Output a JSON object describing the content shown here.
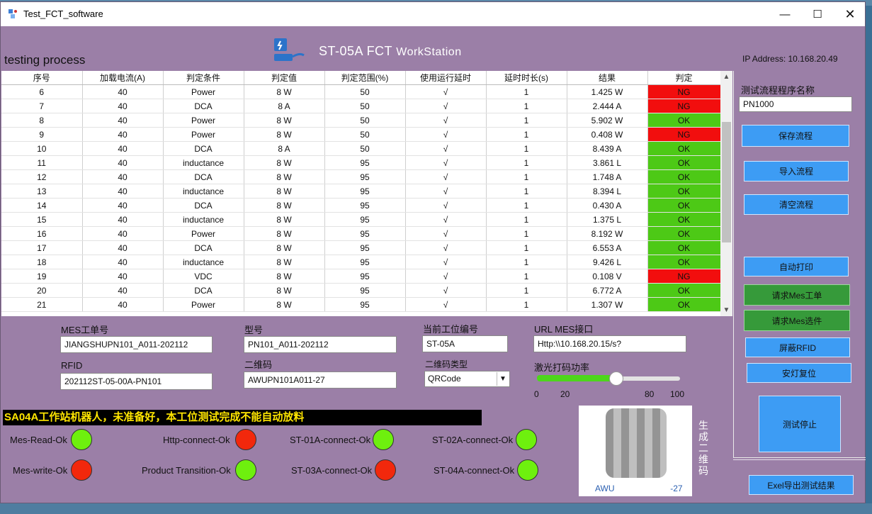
{
  "window": {
    "title": "Test_FCT_software",
    "controls": [
      "—",
      "☐",
      "✕"
    ]
  },
  "header": {
    "process_title": "testing process",
    "station_code": "ST-05A",
    "fct": "FCT",
    "workstation": "WorkStation",
    "ip_label": "IP Address:",
    "ip_value": "10.168.20.49"
  },
  "table": {
    "columns": [
      "序号",
      "加载电流(A)",
      "判定条件",
      "判定值",
      "判定范围(%)",
      "使用运行延时",
      "延时时长(s)",
      "结果",
      "判定"
    ],
    "rows": [
      [
        "6",
        "40",
        "Power",
        "8 W",
        "50",
        "√",
        "1",
        "1.425 W",
        "NG"
      ],
      [
        "7",
        "40",
        "DCA",
        "8 A",
        "50",
        "√",
        "1",
        "2.444 A",
        "NG"
      ],
      [
        "8",
        "40",
        "Power",
        "8 W",
        "50",
        "√",
        "1",
        "5.902 W",
        "OK"
      ],
      [
        "9",
        "40",
        "Power",
        "8 W",
        "50",
        "√",
        "1",
        "0.408 W",
        "NG"
      ],
      [
        "10",
        "40",
        "DCA",
        "8 A",
        "50",
        "√",
        "1",
        "8.439 A",
        "OK"
      ],
      [
        "11",
        "40",
        "inductance",
        "8 W",
        "95",
        "√",
        "1",
        "3.861 L",
        "OK"
      ],
      [
        "12",
        "40",
        "DCA",
        "8 W",
        "95",
        "√",
        "1",
        "1.748 A",
        "OK"
      ],
      [
        "13",
        "40",
        "inductance",
        "8 W",
        "95",
        "√",
        "1",
        "8.394 L",
        "OK"
      ],
      [
        "14",
        "40",
        "DCA",
        "8 W",
        "95",
        "√",
        "1",
        "0.430 A",
        "OK"
      ],
      [
        "15",
        "40",
        "inductance",
        "8 W",
        "95",
        "√",
        "1",
        "1.375 L",
        "OK"
      ],
      [
        "16",
        "40",
        "Power",
        "8 W",
        "95",
        "√",
        "1",
        "8.192 W",
        "OK"
      ],
      [
        "17",
        "40",
        "DCA",
        "8 W",
        "95",
        "√",
        "1",
        "6.553 A",
        "OK"
      ],
      [
        "18",
        "40",
        "inductance",
        "8 W",
        "95",
        "√",
        "1",
        "9.426 L",
        "OK"
      ],
      [
        "19",
        "40",
        "VDC",
        "8 W",
        "95",
        "√",
        "1",
        "0.108 V",
        "NG"
      ],
      [
        "20",
        "40",
        "DCA",
        "8 W",
        "95",
        "√",
        "1",
        "6.772 A",
        "OK"
      ],
      [
        "21",
        "40",
        "Power",
        "8 W",
        "95",
        "√",
        "1",
        "1.307 W",
        "OK"
      ]
    ],
    "ok_color": "#4dc916",
    "ng_color": "#f20e0e"
  },
  "right_panel": {
    "program_label": "测试流程程序名称",
    "program_value": "PN1000",
    "save_flow": "保存流程",
    "import_flow": "导入流程",
    "clear_flow": "清空流程",
    "auto_print": "自动打印",
    "request_mes_order": "请求Mes工单",
    "request_mes_select": "请求Mes选件",
    "block_rfid": "屏蔽RFID",
    "safety_reset": "安灯复位",
    "stop_test": "测试停止",
    "export_results": "Exel导出测试结果"
  },
  "form": {
    "mes_order_label": "MES工单号",
    "mes_order_value": "JIANGSHUPN101_A011-202112",
    "model_label": "型号",
    "model_value": "PN101_A011-202112",
    "station_no_label": "当前工位编号",
    "station_no_value": "ST-05A",
    "url_label": "URL MES接口",
    "url_value": "Http:\\\\10.168.20.15/s?",
    "rfid_label": "RFID",
    "rfid_value": "202112ST-05-00A-PN101",
    "qrcode_label": "二维码",
    "qrcode_value": "AWUPN101A011-27",
    "qrtype_label": "二维码类型",
    "qrtype_value": "QRCode",
    "laser_label": "激光打码功率",
    "laser_level_percent": 55,
    "laser_ticks": [
      "0",
      "20",
      "",
      "",
      "80",
      "100"
    ]
  },
  "notice": "SA04A工作站机器人，未准备好，本工位测试完成不能自动放料",
  "status": [
    {
      "label": "Mes-Read-Ok",
      "state": "green"
    },
    {
      "label": "Http-connect-Ok",
      "state": "red"
    },
    {
      "label": "ST-01A-connect-Ok",
      "state": "green"
    },
    {
      "label": "ST-02A-connect-Ok",
      "state": "green"
    },
    {
      "label": "Mes-write-Ok",
      "state": "red"
    },
    {
      "label": "Product Transition-Ok",
      "state": "green"
    },
    {
      "label": "ST-03A-connect-Ok",
      "state": "red"
    },
    {
      "label": "ST-04A-connect-Ok",
      "state": "green"
    }
  ],
  "qr": {
    "caption_left": "AWU",
    "caption_right": "-27",
    "generate_label": "生成二维码"
  }
}
